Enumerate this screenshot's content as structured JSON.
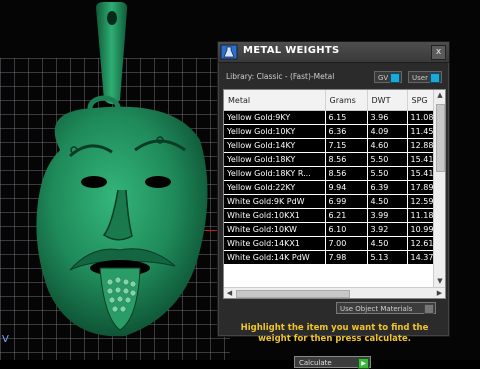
{
  "viewport": {
    "corner_label": "V"
  },
  "panel": {
    "title": "METAL WEIGHTS",
    "close_glyph": "x",
    "library_label": "Library: Classic - (Fast)-Metal",
    "toggles": [
      {
        "label": "GV"
      },
      {
        "label": "User"
      }
    ],
    "table": {
      "columns": [
        "Metal",
        "Grams",
        "DWT",
        "SPG"
      ],
      "rows": [
        [
          "Yellow Gold:9KY",
          "6.15",
          "3.96",
          "11.08"
        ],
        [
          "Yellow Gold:10KY",
          "6.36",
          "4.09",
          "11.45"
        ],
        [
          "Yellow Gold:14KY",
          "7.15",
          "4.60",
          "12.88"
        ],
        [
          "Yellow Gold:18KY",
          "8.56",
          "5.50",
          "15.41"
        ],
        [
          "Yellow Gold:18KY R...",
          "8.56",
          "5.50",
          "15.41"
        ],
        [
          "Yellow Gold:22KY",
          "9.94",
          "6.39",
          "17.89"
        ],
        [
          "White Gold:9K PdW",
          "6.99",
          "4.50",
          "12.59"
        ],
        [
          "White Gold:10KX1",
          "6.21",
          "3.99",
          "11.18"
        ],
        [
          "White Gold:10KW",
          "6.10",
          "3.92",
          "10.99"
        ],
        [
          "White Gold:14KX1",
          "7.00",
          "4.50",
          "12.61"
        ],
        [
          "White Gold:14K PdW",
          "7.98",
          "5.13",
          "14.37"
        ]
      ]
    },
    "use_object_materials": "Use Object Materials",
    "hint": "Highlight the item you want to find the weight for then press calculate.",
    "calculate_label": "Calculate"
  },
  "colors": {
    "model_green": "#1f8a5a",
    "hint_yellow": "#f0c52a",
    "toggle_blue": "#1ea8d8"
  }
}
